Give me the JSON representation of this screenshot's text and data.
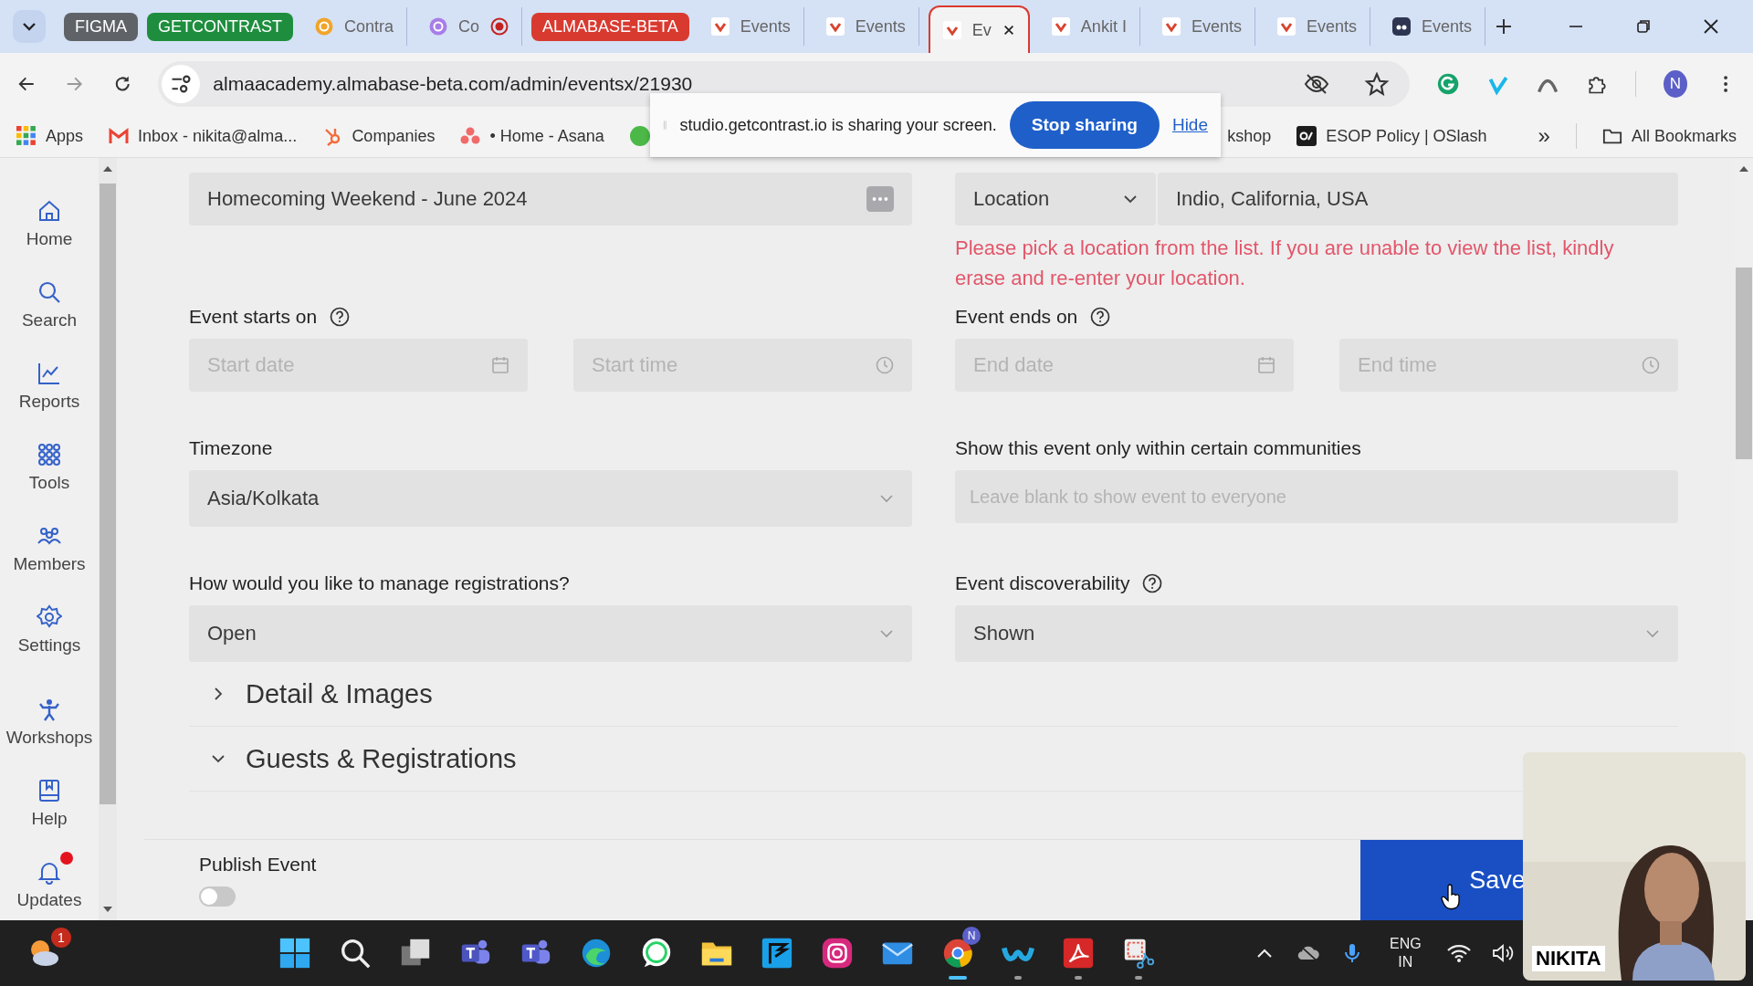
{
  "browser": {
    "tabs": [
      {
        "kind": "group",
        "label": "FIGMA",
        "color": "#5f6368"
      },
      {
        "kind": "group",
        "label": "GETCONTRAST",
        "color": "#1e8e3e"
      },
      {
        "kind": "circle-page",
        "title": "Contra",
        "color": "#f0a52a",
        "selected": false,
        "recording": false
      },
      {
        "kind": "circle-page",
        "title": "Co",
        "color": "#a77de8",
        "selected": false,
        "recording": true
      },
      {
        "kind": "group",
        "label": "ALMABASE-BETA",
        "color": "#d93a30"
      },
      {
        "kind": "check-page",
        "title": "Events",
        "selected": false,
        "recording": false
      },
      {
        "kind": "check-page",
        "title": "Events",
        "selected": false,
        "recording": false
      },
      {
        "kind": "check-page",
        "title": "Ev",
        "selected": true,
        "recording": false
      },
      {
        "kind": "check-page",
        "title": "Ankit I",
        "selected": false,
        "recording": false
      },
      {
        "kind": "check-page",
        "title": "Events",
        "selected": false,
        "recording": false
      },
      {
        "kind": "check-page",
        "title": "Events",
        "selected": false,
        "recording": false
      },
      {
        "kind": "square-page",
        "title": "Events",
        "selected": false,
        "recording": false
      }
    ],
    "url": "almaacademy.almabase-beta.com/admin/eventsx/21930",
    "avatar": "N",
    "bookmarks": [
      {
        "kind": "apps",
        "label": "Apps"
      },
      {
        "kind": "mail",
        "label": "Inbox - nikita@alma..."
      },
      {
        "kind": "hub",
        "label": "Companies"
      },
      {
        "kind": "dots",
        "label": "• Home - Asana"
      },
      {
        "kind": "round"
      }
    ],
    "bookmarks_after": [
      {
        "kind": "plain",
        "label": "kshop"
      },
      {
        "kind": "square",
        "label": "ESOP Policy | OSlash"
      }
    ],
    "more": "»",
    "all_bookmarks": "All Bookmarks"
  },
  "share_bar": {
    "message": "studio.getcontrast.io is sharing your screen.",
    "stop": "Stop sharing",
    "hide": "Hide"
  },
  "sidebar": [
    {
      "kind": "home",
      "label": "Home",
      "badge": false
    },
    {
      "kind": "search",
      "label": "Search",
      "badge": false
    },
    {
      "kind": "reports",
      "label": "Reports",
      "badge": false
    },
    {
      "kind": "tools",
      "label": "Tools",
      "badge": false
    },
    {
      "kind": "members",
      "label": "Members",
      "badge": false
    },
    {
      "kind": "settings",
      "label": "Settings",
      "badge": false
    },
    {
      "kind": "workshops",
      "label": "Workshops",
      "badge": false
    },
    {
      "kind": "help",
      "label": "Help",
      "badge": false
    },
    {
      "kind": "updates",
      "label": "Updates",
      "badge": true
    }
  ],
  "form": {
    "title_field": {
      "value": "Homecoming Weekend - June 2024"
    },
    "location": {
      "type": "Location",
      "value": "Indio, California, USA",
      "error": "Please pick a location from the list. If you are unable to view the list, kindly erase and re-enter your location."
    },
    "starts": {
      "label": "Event starts on",
      "help": true,
      "date_placeholder": "Start date",
      "time_placeholder": "Start time"
    },
    "ends": {
      "label": "Event ends on",
      "help": true,
      "date_placeholder": "End date",
      "time_placeholder": "End time"
    },
    "timezone": {
      "label": "Timezone",
      "help": false,
      "value": "Asia/Kolkata"
    },
    "communities": {
      "label": "Show this event only within certain communities",
      "help": false,
      "placeholder": "Leave blank to show event to everyone"
    },
    "registrations": {
      "label": "How would you like to manage registrations?",
      "help": false,
      "value": "Open"
    },
    "discoverability": {
      "label": "Event discoverability",
      "help": true,
      "value": "Shown"
    }
  },
  "sections": [
    {
      "title": "Detail & Images",
      "expanded": false
    },
    {
      "title": "Guests & Registrations",
      "expanded": true
    }
  ],
  "footer": {
    "publish_label": "Publish Event",
    "publish_on": false,
    "save": "Save"
  },
  "taskbar": {
    "weather_badge": "1",
    "apps": [
      {
        "kind": "windows",
        "active": false,
        "running": false
      },
      {
        "kind": "search",
        "active": false,
        "running": false
      },
      {
        "kind": "taskview",
        "active": false,
        "running": false
      },
      {
        "kind": "teams",
        "active": false,
        "running": false
      },
      {
        "kind": "teams2",
        "active": false,
        "running": false
      },
      {
        "kind": "edge",
        "active": false,
        "running": false
      },
      {
        "kind": "chat",
        "active": false,
        "running": false
      },
      {
        "kind": "folder",
        "active": false,
        "running": false
      },
      {
        "kind": "flag",
        "active": false,
        "running": false
      },
      {
        "kind": "camera",
        "active": false,
        "running": false
      },
      {
        "kind": "mail",
        "active": false,
        "running": false
      },
      {
        "kind": "chrome",
        "active": true,
        "running": true,
        "badge": "N"
      },
      {
        "kind": "webex",
        "active": false,
        "running": true
      },
      {
        "kind": "acrobat",
        "active": false,
        "running": true
      },
      {
        "kind": "snip",
        "active": false,
        "running": true
      }
    ],
    "language": "ENG",
    "region": "IN"
  },
  "webcam": {
    "name": "NIKITA"
  }
}
